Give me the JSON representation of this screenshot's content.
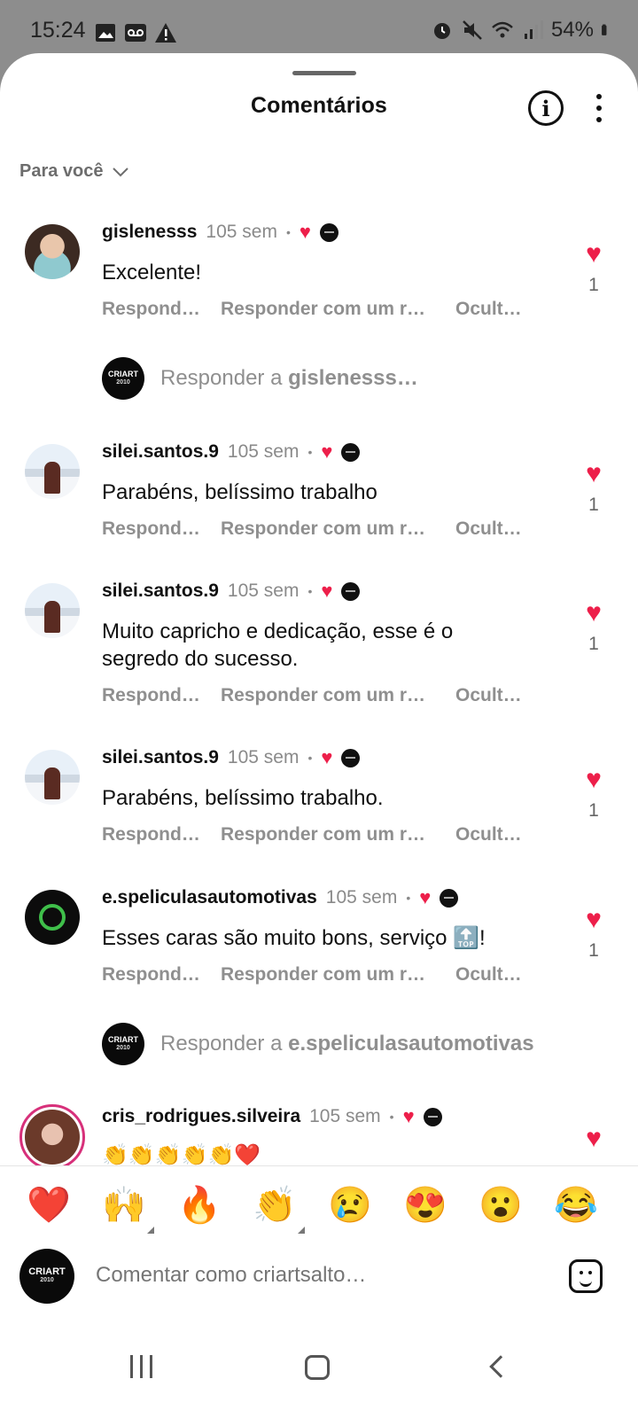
{
  "status": {
    "time": "15:24",
    "battery": "54%"
  },
  "header": {
    "title": "Comentários"
  },
  "filter": {
    "label": "Para você"
  },
  "comments": [
    {
      "user": "gislenesss",
      "time": "105 sem",
      "text": "Excelente!",
      "likes": "1"
    },
    {
      "user": "silei.santos.9",
      "time": "105 sem",
      "text": "Parabéns, belíssimo trabalho",
      "likes": "1"
    },
    {
      "user": "silei.santos.9",
      "time": "105 sem",
      "text": "Muito capricho e dedicação, esse é o segredo do sucesso.",
      "likes": "1"
    },
    {
      "user": "silei.santos.9",
      "time": "105 sem",
      "text": "Parabéns, belíssimo trabalho.",
      "likes": "1"
    },
    {
      "user": "e.speliculasautomotivas",
      "time": "105 sem",
      "text": "Esses caras são muito bons, serviço 🔝!",
      "likes": "1"
    },
    {
      "user": "cris_rodrigues.silveira",
      "time": "105 sem",
      "text": "👏👏👏👏👏❤️"
    }
  ],
  "actions": {
    "reply": "Respond…",
    "reply_with": "Responder com um r…",
    "hide": "Ocult…"
  },
  "replies": [
    {
      "prefix": "Responder a ",
      "user": "gislenesss…"
    },
    {
      "prefix": "Responder a ",
      "user": "e.speliculasautomotivas"
    }
  ],
  "brand": {
    "name": "CRIART",
    "year": "2010"
  },
  "reactions": [
    "❤️",
    "🙌",
    "🔥",
    "👏",
    "😢",
    "😍",
    "😮",
    "😂"
  ],
  "composer": {
    "placeholder": "Comentar como criartsalto…"
  },
  "colors": {
    "heart": "#ed1f4a",
    "sheet": "#ffffff",
    "muted": "#8f8f8f"
  }
}
